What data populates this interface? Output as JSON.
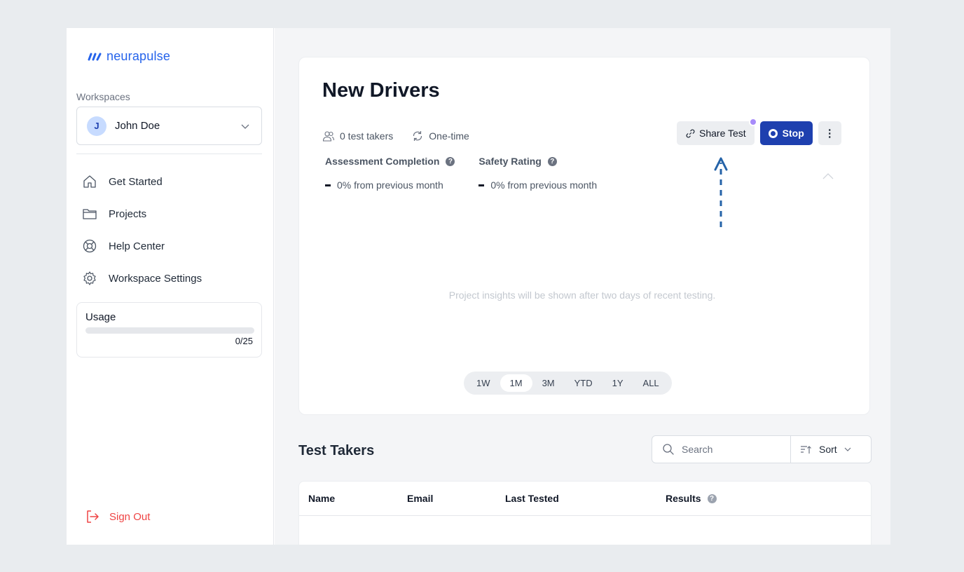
{
  "brand": {
    "name": "neurapulse",
    "color": "#2563eb"
  },
  "sidebar": {
    "workspaces_label": "Workspaces",
    "workspace": {
      "avatar_initial": "J",
      "name": "John Doe"
    },
    "nav": [
      {
        "label": "Get Started",
        "icon": "home-icon"
      },
      {
        "label": "Projects",
        "icon": "folder-icon"
      },
      {
        "label": "Help Center",
        "icon": "lifebuoy-icon"
      },
      {
        "label": "Workspace Settings",
        "icon": "gear-icon"
      }
    ],
    "usage": {
      "label": "Usage",
      "count": "0/25",
      "used": 0,
      "total": 25
    },
    "sign_out": "Sign Out"
  },
  "project": {
    "title": "New Drivers",
    "test_takers": "0 test takers",
    "frequency": "One-time",
    "share_label": "Share Test",
    "stop_label": "Stop",
    "more_label": "⋮",
    "metrics": [
      {
        "label": "Assessment Completion",
        "delta": "0% from previous month"
      },
      {
        "label": "Safety Rating",
        "delta": "0% from previous month"
      }
    ],
    "insights_message": "Project insights will be shown after two days of recent testing.",
    "ranges": [
      "1W",
      "1M",
      "3M",
      "YTD",
      "1Y",
      "ALL"
    ],
    "active_range": "1M"
  },
  "test_takers": {
    "title": "Test Takers",
    "search_placeholder": "Search",
    "sort_label": "Sort",
    "columns": [
      "Name",
      "Email",
      "Last Tested",
      "Results"
    ],
    "rows": []
  },
  "colors": {
    "accent": "#2563eb",
    "stop_button": "#1e40af",
    "notify_dot": "#a78bfa",
    "sign_out": "#ef4444",
    "annotation_arrow": "#2563a8"
  }
}
